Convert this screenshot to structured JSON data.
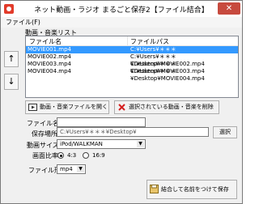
{
  "window": {
    "title": "ネット動画・ラジオ まるごと保存2【ファイル結合】"
  },
  "menu": {
    "file": "ファイル(F)"
  },
  "list": {
    "label": "動画・音楽リスト",
    "headers": [
      "ファイル名",
      "ファイルパス"
    ],
    "rows": [
      {
        "name": "MOVIE001.mp4",
        "path": "C:¥Users¥＊＊＊¥Desktop¥MOVIE001.mp4",
        "selected": true
      },
      {
        "name": "MOVIE002.mp4",
        "path": "C:¥Users¥＊＊＊¥Desktop¥MOVIE002.mp4",
        "selected": false
      },
      {
        "name": "MOVIE003.mp4",
        "path": "C:¥Users¥＊＊＊¥Desktop¥MOVIE003.mp4",
        "selected": false
      },
      {
        "name": "MOVIE004.mp4",
        "path": "C:¥Users¥＊＊＊¥Desktop¥MOVIE004.mp4",
        "selected": false
      }
    ]
  },
  "side": {
    "up": "↑",
    "down": "↓"
  },
  "buttons": {
    "open": "動画・音楽ファイルを開く",
    "remove": "選択されている動画・音楽を削除",
    "browse": "選択",
    "save": "結合して名前をつけて保存"
  },
  "form": {
    "filename_label": "ファイル名",
    "filename_value": "",
    "savepath_label": "保存場所",
    "savepath_value": "C:¥Users¥＊＊＊¥Desktop¥",
    "size_label": "動画サイズ",
    "size_value": "iPod/WALKMAN",
    "ratio_label": "画面比率",
    "ratio_opt1": "4:3",
    "ratio_opt2": "16:9",
    "format_label": "ファイル形式",
    "format_value": "mp4"
  }
}
